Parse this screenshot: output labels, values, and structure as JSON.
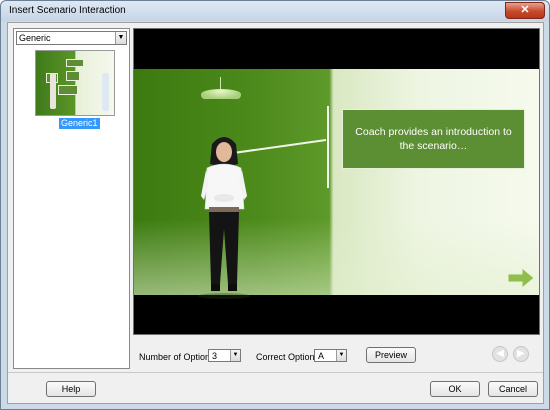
{
  "window": {
    "title": "Insert Scenario Interaction",
    "close_label": "✕"
  },
  "left_panel": {
    "category_select": {
      "value": "Generic"
    },
    "thumbnails": [
      {
        "caption": "Generic1",
        "selected": true
      }
    ]
  },
  "preview": {
    "callout_text": "Coach provides an introduction to the scenario…",
    "accent_color": "#5c8e34"
  },
  "options": {
    "number_of_options_label": "Number of Options",
    "number_of_options_value": "3",
    "correct_option_label": "Correct Option",
    "correct_option_value": "A",
    "preview_button": "Preview"
  },
  "footer": {
    "help_button": "Help",
    "ok_button": "OK",
    "cancel_button": "Cancel"
  },
  "icons": {
    "nav_back": "circle-back-arrow-icon",
    "nav_forward": "circle-forward-arrow-icon"
  }
}
